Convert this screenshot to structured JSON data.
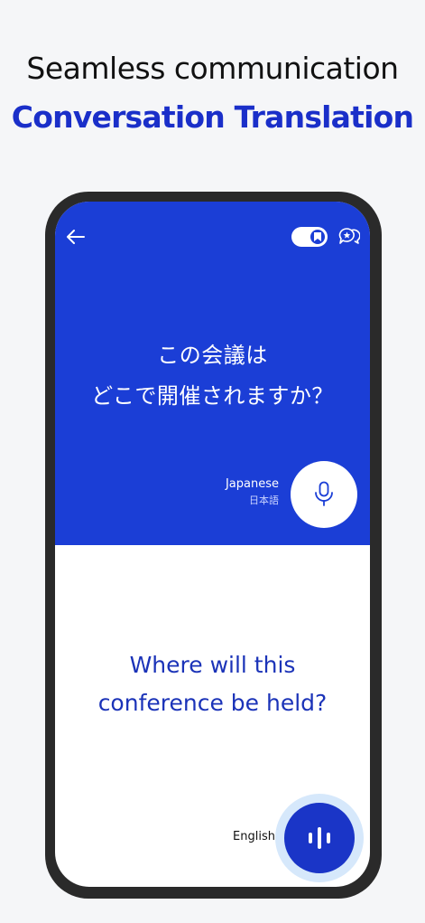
{
  "promo": {
    "line1": "Seamless communication",
    "line2": "Conversation Translation"
  },
  "header": {
    "back_icon": "back-arrow-icon",
    "toggle_icon": "bookmark-toggle",
    "chat_icon": "chat-star-icon"
  },
  "source": {
    "text": "この会議は\nどこで開催されますか？",
    "language": "Japanese",
    "language_native": "日本語",
    "mic_icon": "microphone-icon"
  },
  "target": {
    "text": "Where will this\nconference be held?",
    "language": "English",
    "voice_icon": "voice-wave-icon"
  },
  "colors": {
    "accent": "#1b3ed6",
    "headline_accent": "#1a2fc9",
    "target_text": "#1b33b8",
    "halo": "#d6e8fb"
  }
}
